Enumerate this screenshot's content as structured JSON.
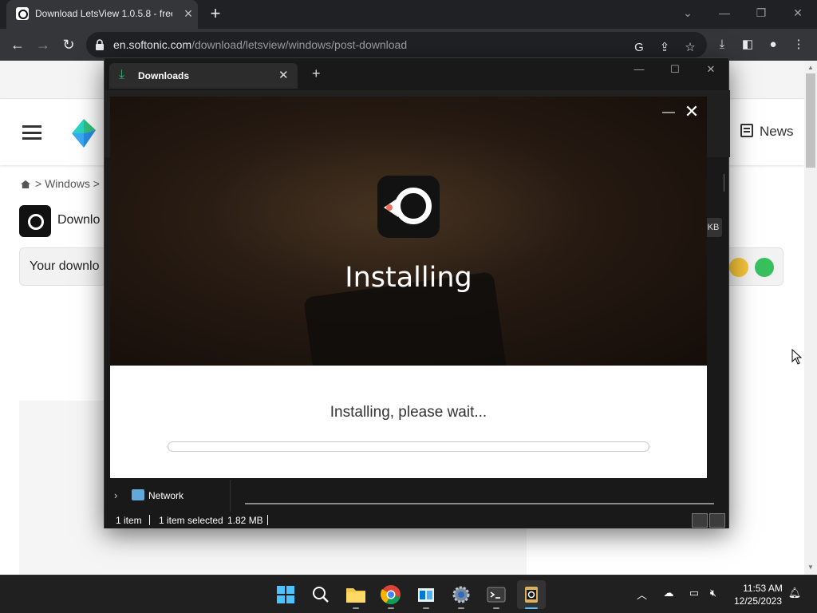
{
  "browser": {
    "tab_title": "Download LetsView 1.0.5.8 - free",
    "url_host": "en.softonic.com",
    "url_path": "/download/letsview/windows/post-download"
  },
  "page": {
    "news_label": "News",
    "breadcrumb": "> Windows >",
    "download_title": "Downlo",
    "download_box_text": "Your downlo"
  },
  "explorer": {
    "tab_title": "Downloads",
    "nav_network": "Network",
    "stub_kb": "KB",
    "status": {
      "item_count": "1 item",
      "selected": "1 item selected",
      "size": "1.82 MB"
    }
  },
  "installer": {
    "title": "Installing",
    "message": "Installing, please wait...",
    "progress": 0.0
  },
  "taskbar": {
    "time": "11:53 AM",
    "date": "12/25/2023",
    "apps": [
      "windows-start",
      "search",
      "file-explorer",
      "chrome",
      "store",
      "settings",
      "terminal",
      "installer"
    ]
  },
  "colors": {
    "chrome_dark": "#35363a",
    "installer_title": "#ffffff",
    "explorer_bg": "#191919"
  }
}
